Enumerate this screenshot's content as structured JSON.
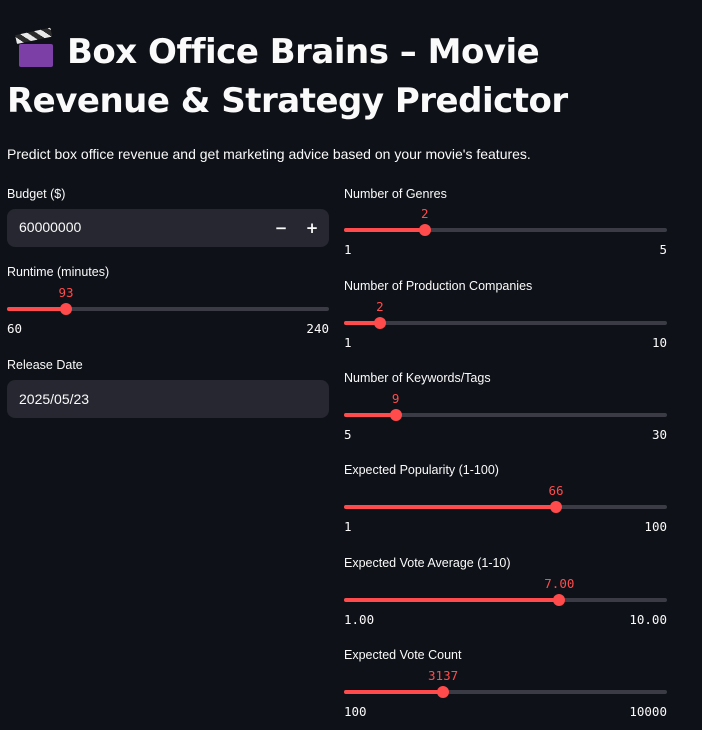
{
  "header": {
    "icon": "clapper-board-icon",
    "title": "Box Office Brains – Movie Revenue & Strategy Predictor",
    "subtitle": "Predict box office revenue and get marketing advice based on your movie's features."
  },
  "left": {
    "budget": {
      "label": "Budget ($)",
      "value": "60000000",
      "minus": "−",
      "plus": "+"
    },
    "runtime": {
      "label": "Runtime (minutes)",
      "value": 93,
      "value_text": "93",
      "min": 60,
      "max": 240,
      "min_text": "60",
      "max_text": "240"
    },
    "release": {
      "label": "Release Date",
      "value": "2025/05/23"
    }
  },
  "right": {
    "genres": {
      "label": "Number of Genres",
      "value": 2,
      "value_text": "2",
      "min": 1,
      "max": 5,
      "min_text": "1",
      "max_text": "5"
    },
    "companies": {
      "label": "Number of Production Companies",
      "value": 2,
      "value_text": "2",
      "min": 1,
      "max": 10,
      "min_text": "1",
      "max_text": "10"
    },
    "keywords": {
      "label": "Number of Keywords/Tags",
      "value": 9,
      "value_text": "9",
      "min": 5,
      "max": 30,
      "min_text": "5",
      "max_text": "30"
    },
    "popularity": {
      "label": "Expected Popularity (1-100)",
      "value": 66,
      "value_text": "66",
      "min": 1,
      "max": 100,
      "min_text": "1",
      "max_text": "100"
    },
    "vote_avg": {
      "label": "Expected Vote Average (1-10)",
      "value": 7.0,
      "value_text": "7.00",
      "min": 1,
      "max": 10,
      "min_text": "1.00",
      "max_text": "10.00"
    },
    "vote_count": {
      "label": "Expected Vote Count",
      "value": 3137,
      "value_text": "3137",
      "min": 100,
      "max": 10000,
      "min_text": "100",
      "max_text": "10000"
    }
  },
  "colors": {
    "accent": "#ff4b4b",
    "background": "#0e1117",
    "input_bg": "#262730",
    "track": "#3a3b45"
  }
}
